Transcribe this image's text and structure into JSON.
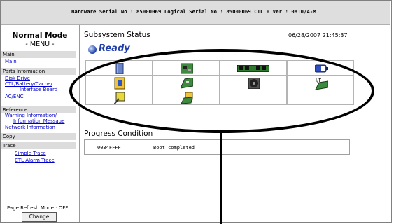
{
  "header": {
    "serial_line": "Hardware Serial No : 85000069  Logical Serial No : 85000069  CTL 0  Ver : 0810/A-M"
  },
  "sidebar": {
    "mode_title": "Normal Mode",
    "menu_label": "- MENU -",
    "sections": {
      "main": "Main",
      "parts": "Parts Information",
      "reference": "Reference",
      "copy": "Copy",
      "trace": "Trace"
    },
    "links": {
      "main": "Main",
      "disk_drive": "Disk Drive",
      "ctl_line1": "CTL/Battery/Cache/",
      "ctl_line2": "Interface Board",
      "ac_enc": "AC/ENC",
      "warning_line1": "Warning Information/",
      "warning_line2": "Information Message",
      "network": "Network Information",
      "simple_trace": "Simple Trace",
      "ctl_alarm_trace": "CTL Alarm Trace"
    },
    "refresh_mode": "Page Refresh Mode : OFF",
    "change_button": "Change"
  },
  "main": {
    "subsystem_title": "Subsystem Status",
    "datetime": "06/28/2007 21:45:37",
    "status": "Ready",
    "icons": [
      "disk-drive-icon",
      "control-board-icon",
      "cache-memory-icon",
      "battery-icon",
      "power-supply-icon",
      "interface-board-icon",
      "fan-icon",
      "if-board-icon",
      "enclosure-icon",
      "host-connector-icon"
    ],
    "progress_title": "Progress Condition",
    "progress_code": "0034FFFF",
    "progress_status": "Boot completed"
  },
  "colors": {
    "ready_blue": "#1f3ea8",
    "link_blue": "#0000cc",
    "header_gray": "#dedede",
    "section_gray": "#dcdcdc"
  }
}
